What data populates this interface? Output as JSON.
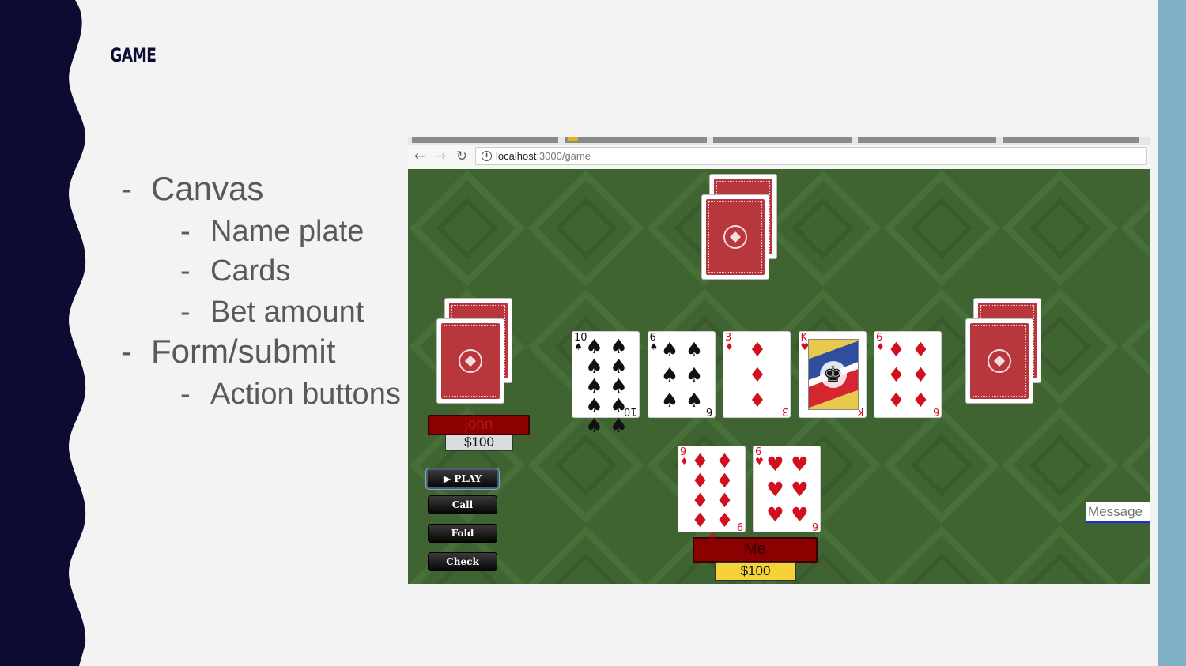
{
  "slide": {
    "title": "GAME",
    "bullets": [
      {
        "text": "Canvas",
        "level": 1
      },
      {
        "text": "Name plate",
        "level": 2
      },
      {
        "text": "Cards",
        "level": 2
      },
      {
        "text": "Bet amount",
        "level": 2
      },
      {
        "text": "Form/submit",
        "level": 1
      },
      {
        "text": "Action buttons",
        "level": 2
      }
    ],
    "bullet_marker": "-"
  },
  "browser": {
    "url_host": "localhost",
    "url_path": ":3000/game",
    "back_icon": "←",
    "forward_icon": "→",
    "reload_icon": "↻",
    "info_icon": "i"
  },
  "game": {
    "community_cards": [
      {
        "rank": "10",
        "suit": "♠",
        "color": "black",
        "pips": 10
      },
      {
        "rank": "6",
        "suit": "♠",
        "color": "black",
        "pips": 6
      },
      {
        "rank": "3",
        "suit": "♦",
        "color": "red",
        "pips": 3
      },
      {
        "rank": "K",
        "suit": "♥",
        "color": "red",
        "pips": 0
      },
      {
        "rank": "6",
        "suit": "♦",
        "color": "red",
        "pips": 6
      }
    ],
    "my_cards": [
      {
        "rank": "9",
        "suit": "♦",
        "color": "red",
        "pips": 9
      },
      {
        "rank": "6",
        "suit": "♥",
        "color": "red",
        "pips": 6
      }
    ],
    "opponent": {
      "name": "john",
      "money": "$100"
    },
    "me": {
      "name": "Me",
      "money": "$100"
    },
    "buttons": {
      "play": "▶ PLAY",
      "call": "Call",
      "fold": "Fold",
      "check": "Check"
    },
    "message_placeholder": "Message",
    "colors": {
      "felt": "#3f6331",
      "card_back": "#b8373d",
      "plate": "#8b0000",
      "my_money_bg": "#f4d238",
      "opponent_money_bg": "#dcdcdc",
      "accent_bar": "#7fb0c4",
      "wave": "#0d0b31"
    }
  }
}
